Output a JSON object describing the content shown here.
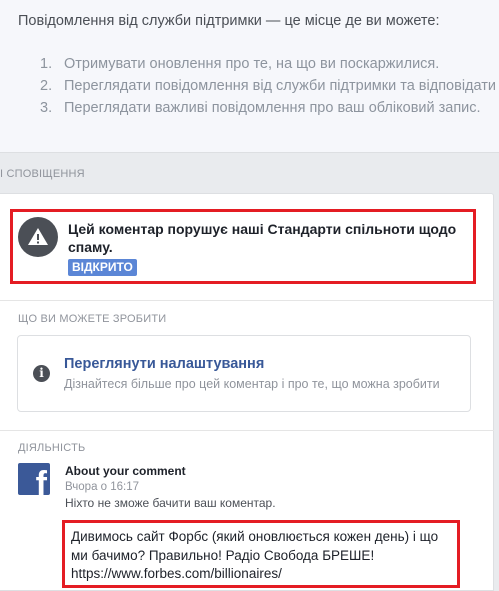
{
  "intro": {
    "text": "Повідомлення від служби підтримки — це місце де ви можете:",
    "items": [
      {
        "num": "1.",
        "text": "Отримувати оновлення про те, на що ви поскаржилися."
      },
      {
        "num": "2.",
        "text": "Переглядати повідомлення від служби підтримки та відповідати н"
      },
      {
        "num": "3.",
        "text": "Переглядати важливі повідомлення про ваш обліковий запис."
      }
    ]
  },
  "section": {
    "header": "І СПОВІЩЕННЯ"
  },
  "alert": {
    "icon": "warning-icon",
    "title": "Цей коментар порушує наші Стандарти спільноти щодо спаму.",
    "status": "ВІДКРИТО"
  },
  "actions": {
    "header": "ЩО ВИ МОЖЕТЕ ЗРОБИТИ",
    "item": {
      "icon": "info-icon",
      "title": "Переглянути налаштування",
      "description": "Дізнайтеся більше про цей коментар і про те, що можна зробити"
    }
  },
  "activity": {
    "header": "ДІЯЛЬНІСТЬ",
    "icon": "facebook-logo",
    "logo_letter": "f",
    "title": "About your comment",
    "time": "Вчора о 16:17",
    "note": "Ніхто не зможе бачити ваш коментар.",
    "comment": "Дивимось сайт Форбс (який оновлюється кожен день) і що ми бачимо? Правильно! Радіо Свобода БРЕШЕ! https://www.forbes.com/billionaires/"
  },
  "colors": {
    "link": "#385898",
    "badge": "#5b86d6",
    "highlight": "#e41c23",
    "facebook": "#3b5998"
  }
}
